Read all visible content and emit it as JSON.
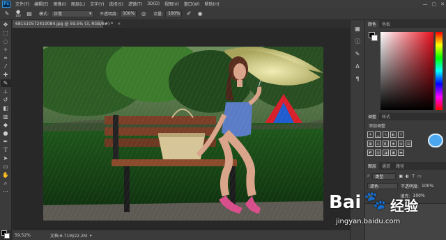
{
  "app": {
    "logo": "Ps",
    "menu": [
      "文件(F)",
      "编辑(E)",
      "图像(I)",
      "图层(L)",
      "文字(Y)",
      "选择(S)",
      "滤镜(T)",
      "3D(D)",
      "视图(V)",
      "窗口(W)",
      "帮助(H)"
    ],
    "window_controls": [
      "—",
      "▢",
      "✕"
    ]
  },
  "options": {
    "brush_size": "100",
    "mode_label": "模式:",
    "mode_value": "正常",
    "opacity_label": "不透明度:",
    "opacity_value": "100%",
    "flow_label": "流量:",
    "flow_value": "100%"
  },
  "document": {
    "tab_title": "681510572410084.jpg @ 59.5% (3, RGB/8#) *",
    "tab_close": "×",
    "zoom": "59.52%",
    "doc_info": "文档:6.71M/22.2M",
    "status_arrow": "▸"
  },
  "panels": {
    "color_tabs": [
      "颜色",
      "色板"
    ],
    "adjust_tabs": [
      "调整",
      "样式"
    ],
    "adjust_label": "添加调整",
    "layer_tabs": [
      "图层",
      "通道",
      "路径"
    ],
    "layer_filter": "类型",
    "blend_mode": "滤色",
    "opacity_label": "不透明度:",
    "opacity_value": "100%",
    "fill_label": "填充:",
    "fill_value": "100%"
  },
  "watermark": {
    "brand": "Bai",
    "brand_suffix": "经验",
    "url": "jingyan.baidu.com"
  },
  "colors": {
    "fg": "#000000",
    "bg": "#ffffff",
    "accent": "#2d9cf0"
  }
}
